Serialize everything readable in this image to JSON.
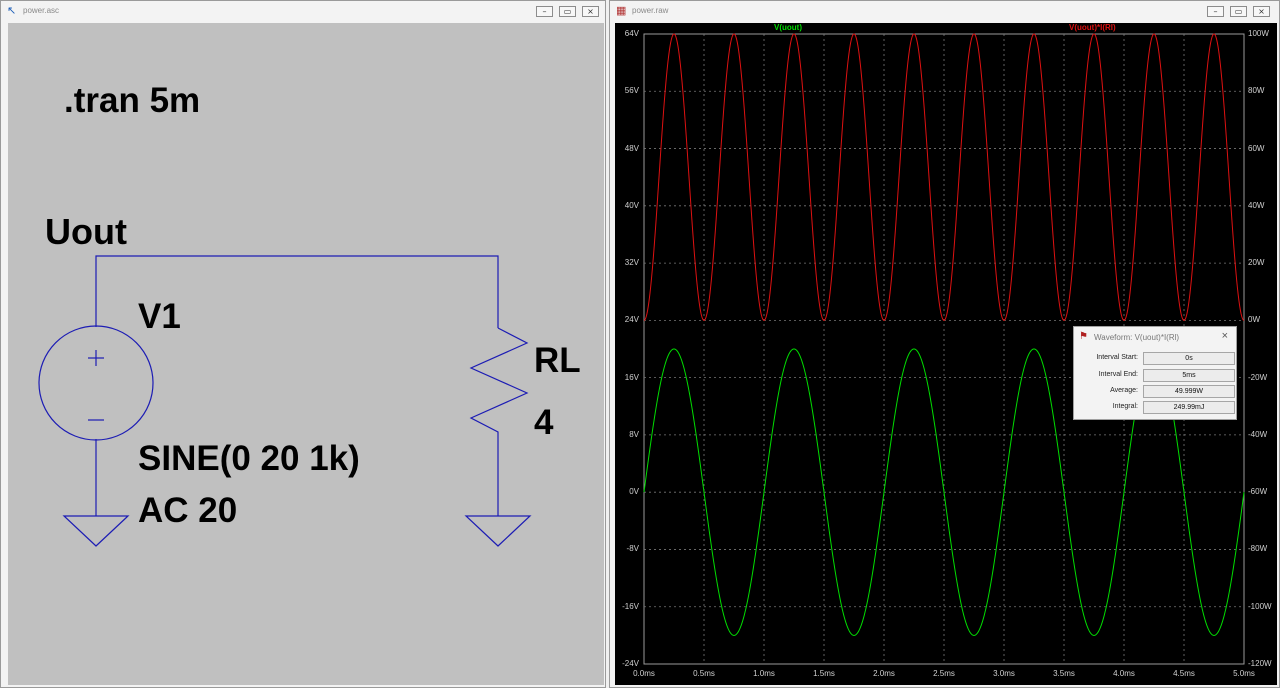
{
  "schematic_window": {
    "title": "power.asc",
    "controls": {
      "minimize": "–",
      "restore": "▭",
      "close": "×"
    },
    "directive": ".tran 5m",
    "net_label": "Uout",
    "source": {
      "name": "V1",
      "value": "SINE(0 20 1k)",
      "ac": "AC 20"
    },
    "resistor": {
      "name": "RL",
      "value": "4"
    }
  },
  "waveform_window": {
    "title": "power.raw",
    "controls": {
      "minimize": "–",
      "restore": "▭",
      "close": "×"
    },
    "trace_labels": {
      "voltage": "V(uout)",
      "power": "V(uout)*I(Rl)"
    },
    "colors": {
      "voltage": "#00dd00",
      "power": "#dd1111",
      "grid": "#777777",
      "background": "#000000"
    }
  },
  "measurement_dialog": {
    "title": "Waveform: V(uout)*I(Rl)",
    "close": "×",
    "rows": [
      {
        "label": "Interval Start:",
        "value": "0s"
      },
      {
        "label": "Interval End:",
        "value": "5ms"
      },
      {
        "label": "Average:",
        "value": "49.999W"
      },
      {
        "label": "Integral:",
        "value": "249.99mJ"
      }
    ]
  },
  "chart_data": {
    "type": "line",
    "title": "",
    "xlabel": "",
    "ylabel": "",
    "xlim": [
      0,
      5
    ],
    "ylim_left": [
      -24,
      64
    ],
    "ylim_right": [
      -120,
      100
    ],
    "grid": true,
    "x_ticks": [
      "0.0ms",
      "0.5ms",
      "1.0ms",
      "1.5ms",
      "2.0ms",
      "2.5ms",
      "3.0ms",
      "3.5ms",
      "4.0ms",
      "4.5ms",
      "5.0ms"
    ],
    "y_ticks_left": [
      "64V",
      "56V",
      "48V",
      "40V",
      "32V",
      "24V",
      "16V",
      "8V",
      "0V",
      "-8V",
      "-16V",
      "-24V"
    ],
    "y_ticks_right": [
      "100W",
      "80W",
      "60W",
      "40W",
      "20W",
      "0W",
      "-20W",
      "-40W",
      "-60W",
      "-80W",
      "-100W",
      "-120W"
    ],
    "series": [
      {
        "name": "V(uout)",
        "axis": "left",
        "function": "20*sin(2*pi*1kHz*t)",
        "amplitude": 20,
        "frequency_khz": 1
      },
      {
        "name": "V(uout)*I(Rl)",
        "axis": "right",
        "function": "100*sin^2(2*pi*1kHz*t)",
        "peak": 100,
        "frequency_khz": 2
      }
    ]
  }
}
